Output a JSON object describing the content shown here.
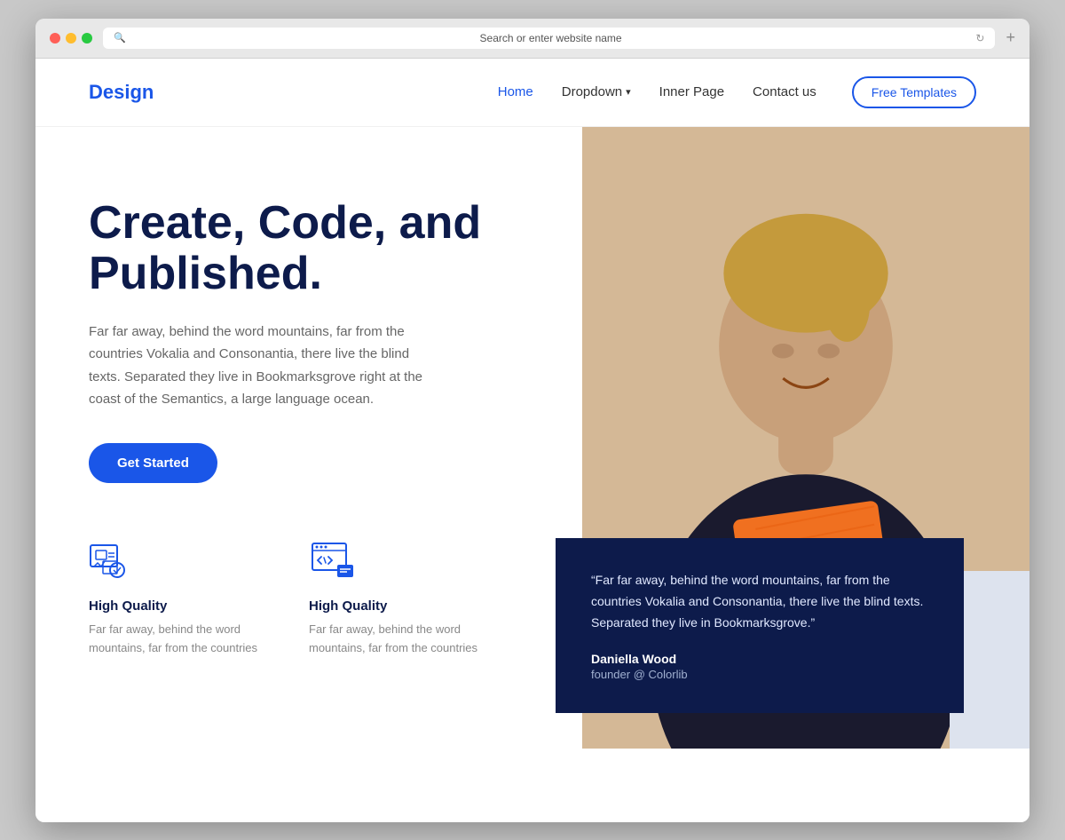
{
  "browser": {
    "address_placeholder": "Search or enter website name"
  },
  "nav": {
    "logo": "Design",
    "links": [
      {
        "label": "Home",
        "active": true
      },
      {
        "label": "Dropdown",
        "dropdown": true
      },
      {
        "label": "Inner Page"
      },
      {
        "label": "Contact us"
      }
    ],
    "cta_label": "Free Templates"
  },
  "hero": {
    "title": "Create, Code, and Published.",
    "description": "Far far away, behind the word mountains, far from the countries Vokalia and Consonantia, there live the blind texts. Separated they live in Bookmarksgrove right at the coast of the Semantics, a large language ocean.",
    "cta_label": "Get Started"
  },
  "features": [
    {
      "icon": "design-icon",
      "title": "High Quality",
      "description": "Far far away, behind the word mountains, far from the countries"
    },
    {
      "icon": "code-icon",
      "title": "High Quality",
      "description": "Far far away, behind the word mountains, far from the countries"
    }
  ],
  "testimonial": {
    "quote": "“Far far away, behind the word mountains, far from the countries Vokalia and Consonantia, there live the blind texts. Separated they live in Bookmarksgrove.”",
    "author": "Daniella Wood",
    "role": "founder @ Colorlib"
  }
}
